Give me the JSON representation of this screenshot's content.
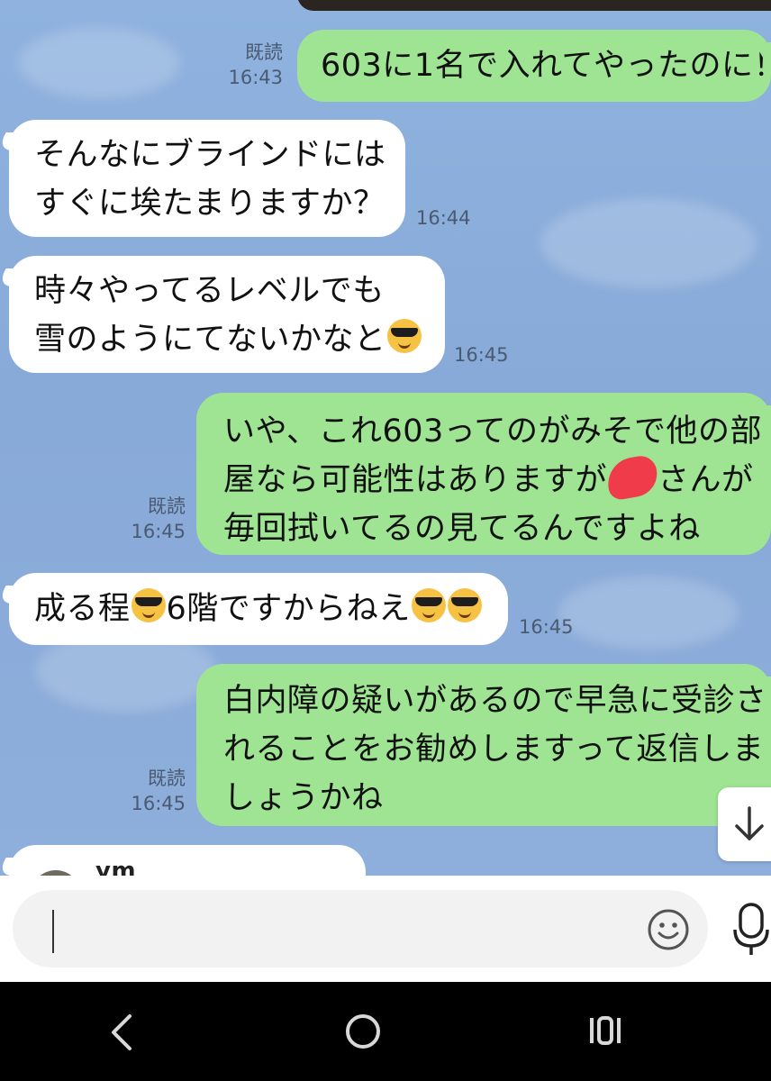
{
  "messages": [
    {
      "side": "out",
      "text": "603に1名で入れてやったのに！",
      "read": "既読",
      "time": "16:43"
    },
    {
      "side": "in",
      "line1": "そんなにブラインドには",
      "line2": "すぐに埃たまりますか？",
      "time": "16:44"
    },
    {
      "side": "in",
      "line1": "時々やってるレベルでも",
      "line2": "雪のようにてないかなと",
      "emoji": "smiling-face-with-sunglasses",
      "time": "16:45"
    },
    {
      "side": "out",
      "line1": "いや、これ603ってのがみそで他の部",
      "line2a": "屋なら可能性はありますが",
      "line2b": "さんが",
      "line3": "毎回拭いてるの見てるんですよね",
      "read": "既読",
      "time": "16:45"
    },
    {
      "side": "in",
      "text_a": "成る程",
      "text_b": "6階ですからねえ",
      "emoji": "smiling-face-with-sunglasses",
      "time": "16:45"
    },
    {
      "side": "out",
      "line1": "白内障の疑いがあるので早急に受診さ",
      "line2": "れることをお勧めしますって返信しま",
      "line3": "しょうかね",
      "read": "既読",
      "time": "16:45"
    },
    {
      "side": "in",
      "partial_name": "ym"
    }
  ],
  "input": {
    "placeholder": "",
    "emoji_icon": "smile-icon",
    "mic_icon": "microphone-icon"
  },
  "scroll_button_icon": "arrow-down-icon",
  "nav": {
    "back_icon": "back-icon",
    "home_icon": "home-icon",
    "recents_icon": "recents-icon"
  },
  "colors": {
    "outgoing_bubble": "#9ee492",
    "incoming_bubble": "#ffffff",
    "chat_bg": "#8fb2df"
  }
}
